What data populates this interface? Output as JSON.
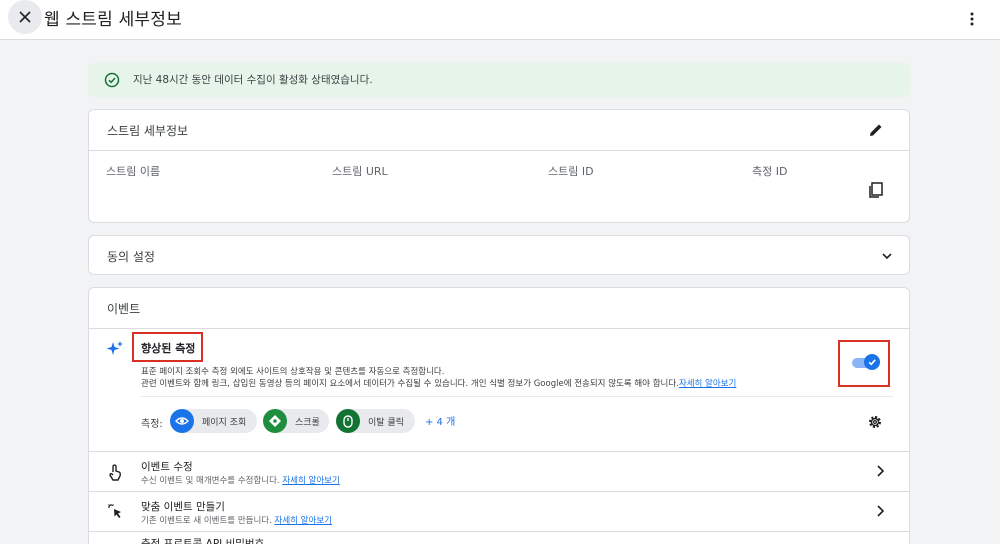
{
  "header": {
    "title": "웹 스트림 세부정보"
  },
  "banner": {
    "text": "지난 48시간 동안 데이터 수집이 활성화 상태였습니다."
  },
  "stream_details": {
    "title": "스트림 세부정보",
    "columns": [
      "스트림 이름",
      "스트림 URL",
      "스트림 ID",
      "측정 ID"
    ]
  },
  "consent": {
    "title": "동의 설정"
  },
  "events": {
    "title": "이벤트",
    "enhanced": {
      "title": "향상된 측정",
      "desc_line1": "표준 페이지 조회수 측정 외에도 사이트의 상호작용 및 콘텐츠를 자동으로 측정합니다.",
      "desc_line2": "관련 이벤트와 함께 링크, 삽입된 동영상 등의 페이지 요소에서 데이터가 수집될 수 있습니다. 개인 식별 정보가 Google에 전송되지 않도록 해야 합니다.",
      "learn_more": "자세히 알아보기",
      "enabled": true
    },
    "measure_label": "측정:",
    "chips": [
      {
        "label": "페이지 조회",
        "icon": "eye-icon",
        "color": "#1a73e8"
      },
      {
        "label": "스크롤",
        "icon": "crosshair-icon",
        "color": "#1e8e3e"
      },
      {
        "label": "이탈 클릭",
        "icon": "mouse-icon",
        "color": "#137333"
      }
    ],
    "more_chips": "+ 4 개",
    "rows": [
      {
        "title": "이벤트 수정",
        "subtitle": "수신 이벤트 및 매개변수를 수정합니다.",
        "link": "자세히 알아보기"
      },
      {
        "title": "맞춤 이벤트 만들기",
        "subtitle": "기존 이벤트로 새 이벤트를 만듭니다.",
        "link": "자세히 알아보기"
      }
    ],
    "row3_title": "측정 프로토콜 API 비밀번호"
  }
}
